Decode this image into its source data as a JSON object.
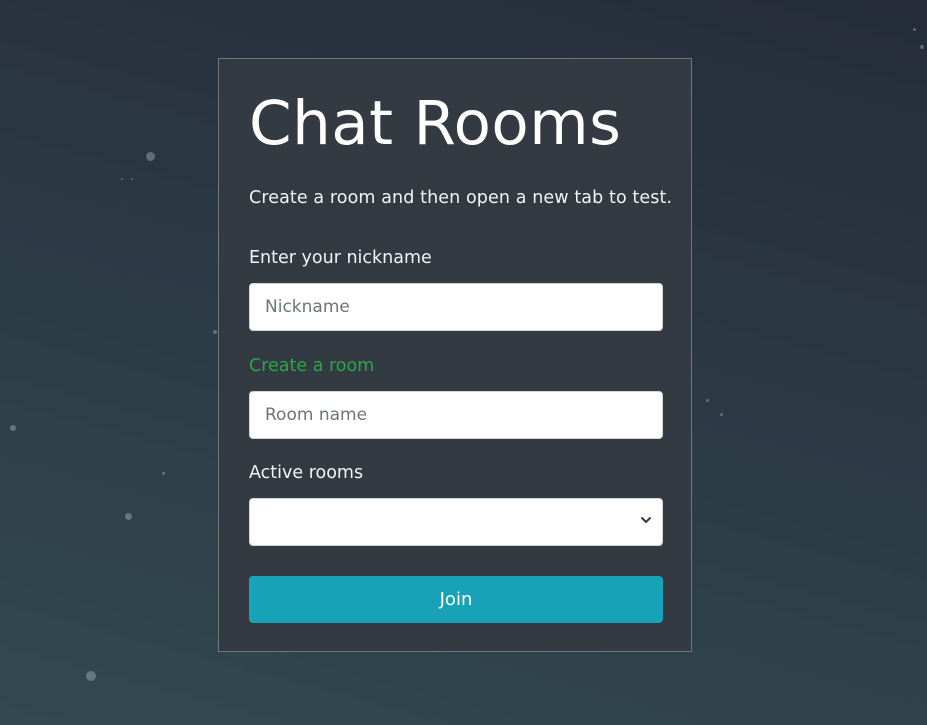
{
  "card": {
    "title": "Chat Rooms",
    "subtitle": "Create a room and then open a new tab to test."
  },
  "nickname": {
    "label": "Enter your nickname",
    "placeholder": "Nickname",
    "value": ""
  },
  "room": {
    "label": "Create a room",
    "placeholder": "Room name",
    "value": ""
  },
  "active_rooms": {
    "label": "Active rooms",
    "selected": ""
  },
  "join_button": {
    "label": "Join"
  },
  "colors": {
    "accent": "#17a2b8",
    "create_label": "#28a745",
    "card_bg": "#343a42"
  }
}
